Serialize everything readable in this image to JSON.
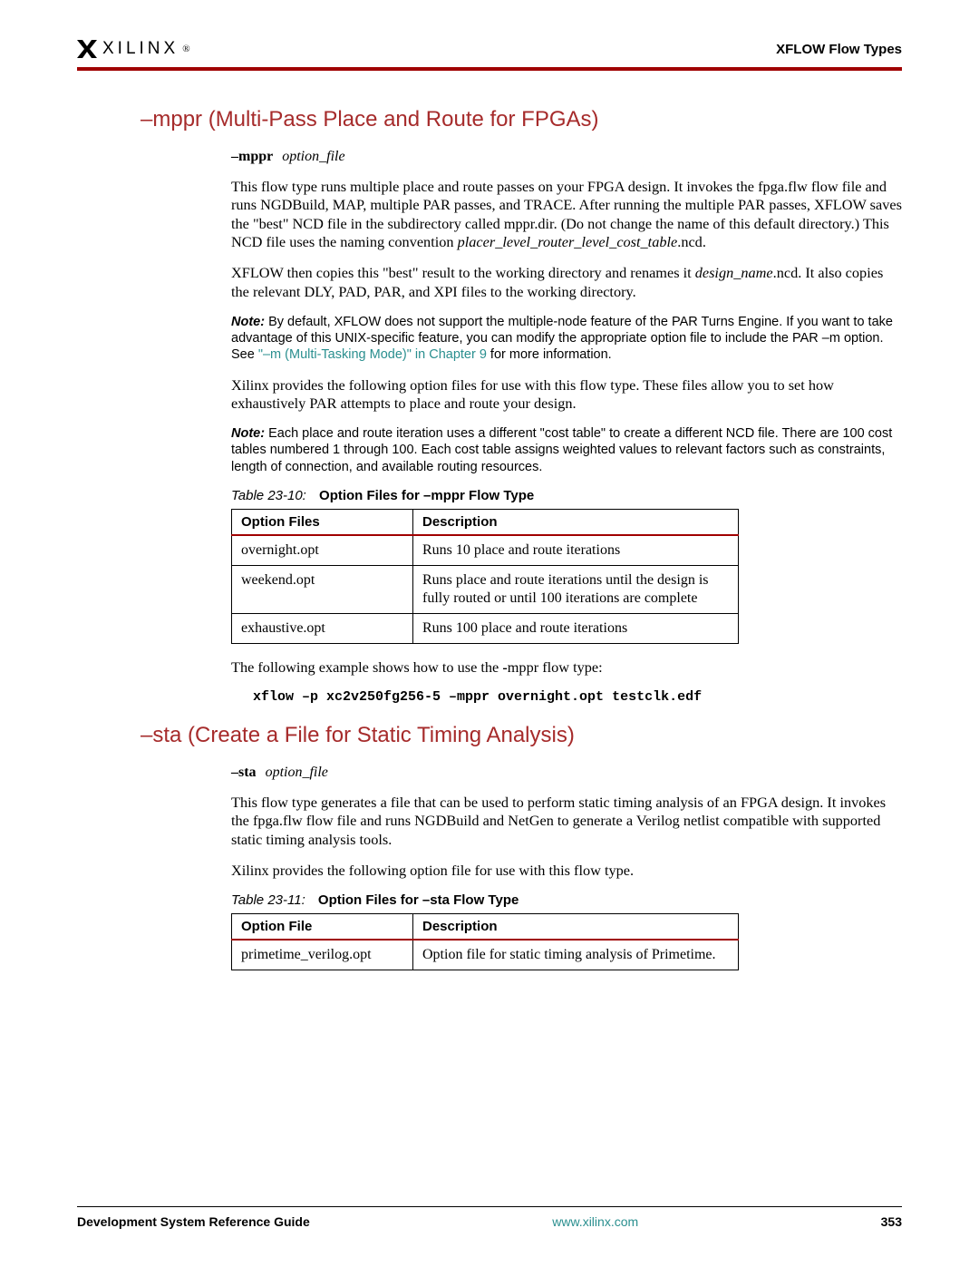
{
  "header": {
    "logo_text": "XILINX",
    "right": "XFLOW Flow Types"
  },
  "mppr": {
    "heading": "–mppr (Multi-Pass Place and Route for FPGAs)",
    "syntax_flag": "–mppr",
    "syntax_arg": "option_file",
    "para1a": "This flow type runs multiple place and route passes on your FPGA design. It invokes the fpga.flw flow file and runs NGDBuild, MAP, multiple PAR passes, and TRACE. After running the multiple PAR passes, XFLOW saves the \"best\" NCD file in the subdirectory called mppr.dir. (Do not change the name of this default directory.) This NCD file uses the naming convention ",
    "para1_ital": "placer_level_router_level_cost_table",
    "para1b": ".ncd.",
    "para2a": "XFLOW then copies this \"best\" result to the working directory and renames it ",
    "para2_ital": "design_name",
    "para2b": ".ncd. It also copies the relevant DLY, PAD, PAR, and XPI files to the working directory.",
    "note1_label": "Note:",
    "note1a": "  By default, XFLOW does not support the multiple-node feature of the PAR Turns Engine. If you want to take advantage of this UNIX-specific feature, you can modify the appropriate option file to include the PAR –m option. See ",
    "note1_link": "\"–m (Multi-Tasking Mode)\" in Chapter 9",
    "note1b": " for more information.",
    "para3": "Xilinx provides the following option files for use with this flow type. These files allow you to set how exhaustively PAR attempts to place and route your design.",
    "note2_label": "Note:",
    "note2": "  Each place and route iteration uses a different \"cost table\" to create a different NCD file. There are 100 cost tables numbered 1 through 100. Each cost table assigns weighted values to relevant factors such as constraints, length of connection, and available routing resources.",
    "table_caption_label": "Table 23-10:",
    "table_caption_title": "Option Files for –mppr Flow Type",
    "th1": "Option Files",
    "th2": "Description",
    "rows": [
      {
        "file": "overnight.opt",
        "desc": "Runs 10 place and route iterations"
      },
      {
        "file": "weekend.opt",
        "desc": "Runs place and route iterations until the design is fully routed or until 100 iterations are complete"
      },
      {
        "file": "exhaustive.opt",
        "desc": "Runs 100 place and route iterations"
      }
    ],
    "para4a": "The following example shows how to use the ",
    "para4_bold": "-",
    "para4b": "mppr flow type:",
    "code": "xflow –p xc2v250fg256-5 –mppr overnight.opt testclk.edf"
  },
  "sta": {
    "heading": "–sta (Create a File for Static Timing Analysis)",
    "syntax_flag": "–sta",
    "syntax_arg": "option_file",
    "para1": "This flow type generates a file that can be used to perform static timing analysis of an FPGA design. It invokes the fpga.flw flow file and runs NGDBuild and NetGen to generate a Verilog netlist compatible with supported static timing analysis tools.",
    "para2": "Xilinx provides the following option file for use with this flow type.",
    "table_caption_label": "Table 23-11:",
    "table_caption_title": "Option Files for –sta Flow Type",
    "th1": "Option File",
    "th2": "Description",
    "rows": [
      {
        "file": "primetime_verilog.opt",
        "desc": "Option file for static timing analysis of Primetime."
      }
    ]
  },
  "footer": {
    "left": "Development System Reference Guide",
    "center": "www.xilinx.com",
    "right": "353"
  }
}
